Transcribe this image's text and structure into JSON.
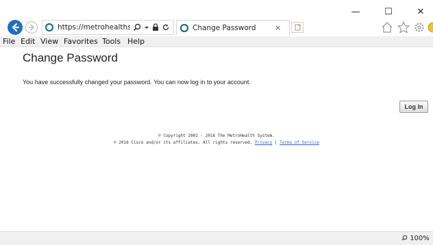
{
  "window": {
    "minimize_glyph": "—",
    "maximize_glyph": "☐",
    "close_glyph": "✕"
  },
  "browser": {
    "address_url": "https://metrohealths...",
    "tab_title": "Change Password",
    "tab_close_glyph": "×",
    "menu": [
      "File",
      "Edit",
      "View",
      "Favorites",
      "Tools",
      "Help"
    ],
    "icons": [
      "back-icon",
      "forward-icon",
      "site-favicon",
      "search-icon",
      "dropdown-icon",
      "lock-icon",
      "refresh-icon",
      "new-tab-icon",
      "home-icon",
      "favorites-star-icon",
      "settings-gear-icon",
      "smiley-feedback-icon"
    ],
    "accent_color": "#1d6fc1"
  },
  "page": {
    "title": "Change Password",
    "message": "You have successfully changed your password. You can now log in to your account.",
    "login_button": "Log In",
    "footer": {
      "line1": "© Copyright 2002 - 2016 The MetroHealth System.",
      "line2_prefix": "© 2016 Cisco and/or its affiliates. All rights reserved.",
      "privacy_link": "Privacy",
      "separator": "|",
      "terms_link": "Terms of Service",
      "link_color": "#2f63c0"
    }
  },
  "statusbar": {
    "zoom": "100%"
  }
}
